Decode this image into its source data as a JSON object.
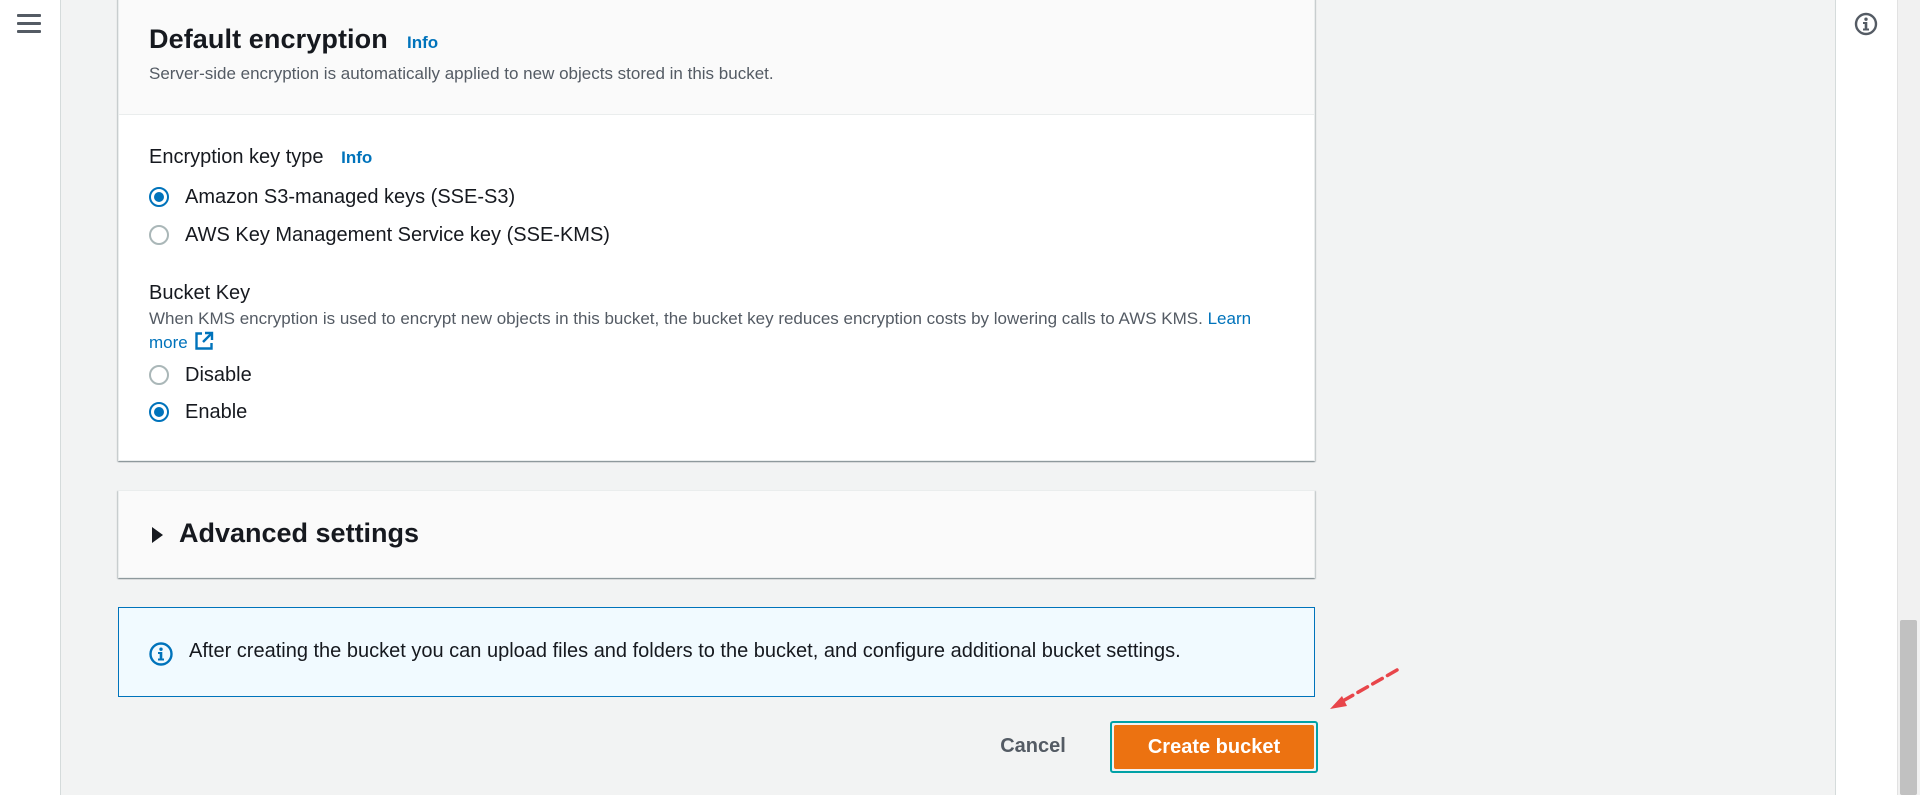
{
  "left_nav": {
    "menu_icon": "hamburger-icon"
  },
  "right_tools": {
    "info_icon": "info-circle-icon"
  },
  "default_encryption": {
    "title": "Default encryption",
    "info_label": "Info",
    "description": "Server-side encryption is automatically applied to new objects stored in this bucket.",
    "key_type": {
      "label": "Encryption key type",
      "info_label": "Info",
      "options": [
        {
          "label": "Amazon S3-managed keys (SSE-S3)",
          "checked": true
        },
        {
          "label": "AWS Key Management Service key (SSE-KMS)",
          "checked": false
        }
      ]
    },
    "bucket_key": {
      "label": "Bucket Key",
      "description": "When KMS encryption is used to encrypt new objects in this bucket, the bucket key reduces encryption costs by lowering calls to AWS KMS.",
      "learn_more": "Learn more",
      "external_icon": "external-link-icon",
      "options": [
        {
          "label": "Disable",
          "checked": false
        },
        {
          "label": "Enable",
          "checked": true
        }
      ]
    }
  },
  "advanced_settings": {
    "title": "Advanced settings",
    "expanded": false
  },
  "info_alert": {
    "icon": "info-circle-icon",
    "text": "After creating the bucket you can upload files and folders to the bucket, and configure additional bucket settings."
  },
  "footer": {
    "cancel_label": "Cancel",
    "create_label": "Create bucket"
  },
  "colors": {
    "primary_button": "#ec7211",
    "focus_ring": "#00a1a6",
    "link": "#0073bb",
    "annotation_arrow": "#e8454a"
  }
}
